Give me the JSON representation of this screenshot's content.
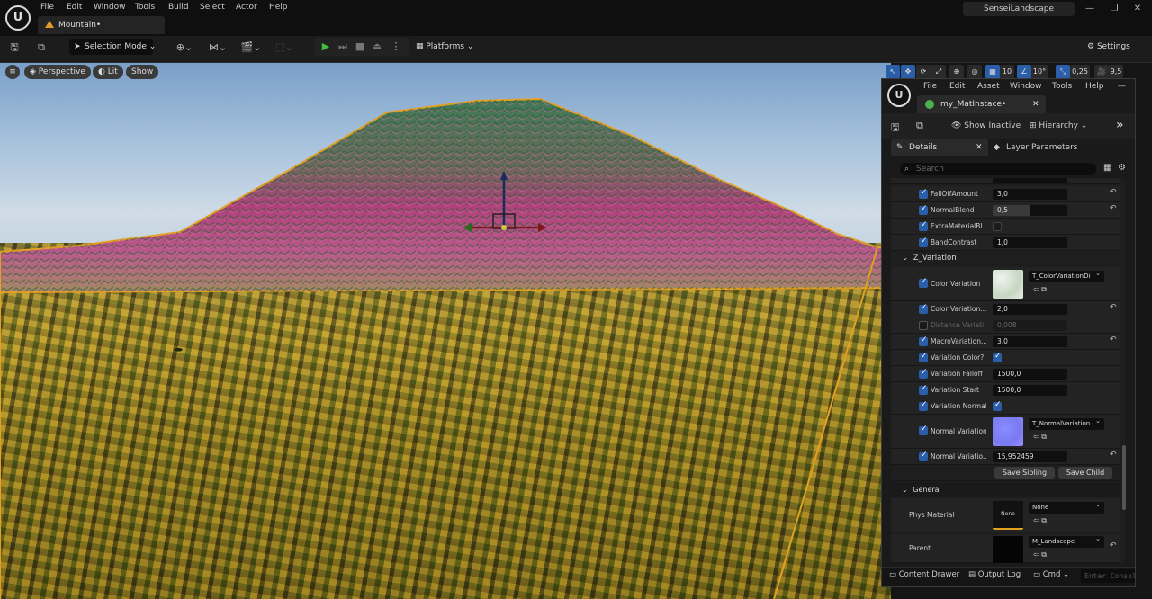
{
  "menu": {
    "file": "File",
    "edit": "Edit",
    "window": "Window",
    "tools": "Tools",
    "build": "Build",
    "select": "Select",
    "actor": "Actor",
    "help": "Help"
  },
  "doc_tab": "Mountain•",
  "project": "SenseiLandscape",
  "toolbar": {
    "selection_mode": "Selection Mode",
    "platforms": "Platforms",
    "settings": "Settings"
  },
  "viewport": {
    "perspective": "Perspective",
    "lit": "Lit",
    "show": "Show",
    "grid_snap": "10",
    "rot_snap": "10°",
    "scale_snap": "0,25",
    "cam_speed": "9,5"
  },
  "mat": {
    "menu": {
      "file": "File",
      "edit": "Edit",
      "asset": "Asset",
      "window": "Window",
      "tools": "Tools",
      "help": "Help"
    },
    "tab": "my_MatInstace•",
    "show_inactive": "Show Inactive",
    "hierarchy": "Hierarchy",
    "details_tab": "Details",
    "layer_tab": "Layer Parameters",
    "search_placeholder": "Search",
    "rows": [
      {
        "label": "FallOffAmount",
        "value": "3,0"
      },
      {
        "label": "NormalBlend",
        "value": "0,5"
      },
      {
        "label": "ExtraMaterialBl..."
      },
      {
        "label": "BandContrast",
        "value": "1,0"
      }
    ],
    "z_variation": "Z_Variation",
    "color_variation_label": "Color Variation",
    "color_variation_tex": "T_ColorVariationDi",
    "cv_amount_label": "Color Variation...",
    "cv_amount": "2,0",
    "distance_label": "Distance Variati...",
    "distance": "0,008",
    "macro_label": "MacroVariation...",
    "macro": "3,0",
    "var_color_label": "Variation Color?",
    "var_falloff_label": "Variation Falloff",
    "var_falloff": "1500,0",
    "var_start_label": "Variation Start",
    "var_start": "1500,0",
    "var_normal_label": "Variation Normal?",
    "normal_var_label": "Normal Variation",
    "normal_var_tex": "T_NormalVariation",
    "normal_var_amt_label": "Normal Variatio...",
    "normal_var_amt": "15,952459",
    "save_sibling": "Save Sibling",
    "save_child": "Save Child",
    "general": "General",
    "phys_label": "Phys Material",
    "phys_thumb": "None",
    "phys_value": "None",
    "parent_label": "Parent",
    "parent_value": "M_Landscape"
  },
  "status": {
    "content_drawer": "Content Drawer",
    "output_log": "Output Log",
    "cmd": "Cmd",
    "console_placeholder": "Enter Console"
  },
  "colors": {
    "accent_green": "#4caf50",
    "play_green": "#3fbf3f",
    "selection_orange": "#e3a021"
  }
}
